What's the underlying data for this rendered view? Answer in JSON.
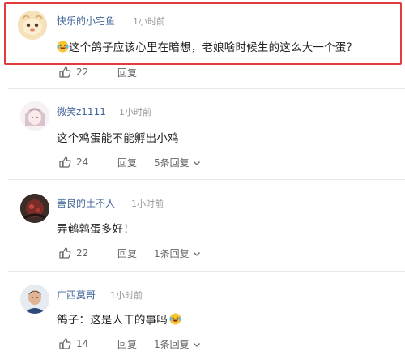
{
  "comments": [
    {
      "username": "快乐的小宅鱼",
      "time": "1小时前",
      "text": "这个鸽子应该心里在暗想，老娘啥时候生的这么大一个蛋？",
      "emoji": "laughing-tears",
      "likes": "22",
      "reply_label": "回复",
      "replies_label": ""
    },
    {
      "username": "微笑z1111",
      "time": "1小时前",
      "text": "这个鸡蛋能不能孵出小鸡",
      "likes": "24",
      "reply_label": "回复",
      "replies_label": "5条回复"
    },
    {
      "username": "善良的土不人",
      "time": "1小时前",
      "text": "弄鹌鹑蛋多好！",
      "likes": "22",
      "reply_label": "回复",
      "replies_label": "1条回复"
    },
    {
      "username": "广西莫哥",
      "time": "1小时前",
      "text": "鸽子：这是人干的事吗",
      "emoji": "laughing-tears",
      "likes": "14",
      "reply_label": "回复",
      "replies_label": "1条回复"
    }
  ],
  "colors": {
    "username": "#406599",
    "highlight_border": "#e23b3b",
    "meta_text": "#999999"
  }
}
